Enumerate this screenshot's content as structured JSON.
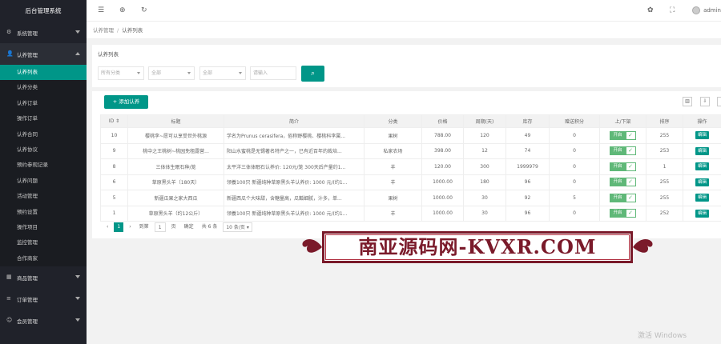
{
  "app_title": "后台管理系统",
  "sidebar": {
    "groups": [
      {
        "label": "系统管理"
      },
      {
        "label": "认养管理"
      },
      {
        "label": "商品管理"
      },
      {
        "label": "订单管理"
      },
      {
        "label": "会员管理"
      }
    ],
    "sub_items": [
      "认养列表",
      "认养分类",
      "认养订单",
      "操作订单",
      "认养合同",
      "认养协议",
      "预约参观记录",
      "认养问题",
      "活动管理",
      "预约设置",
      "操作项目",
      "监控管理",
      "合作商家"
    ]
  },
  "header": {
    "user": "admin"
  },
  "breadcrumb": {
    "parent": "认养管理",
    "sep": "/",
    "current": "认养列表"
  },
  "filter": {
    "title": "认养列表",
    "select1": "所有分类",
    "select2": "全部",
    "select3": "全部",
    "keyword_placeholder": "请输入"
  },
  "toolbar": {
    "add_label": "添加认养"
  },
  "table": {
    "headers": [
      "ID ⇕",
      "标题",
      "简介",
      "分类",
      "价格",
      "周期(天)",
      "库存",
      "赠送积分",
      "上/下架",
      "排序",
      "操作"
    ],
    "rows": [
      {
        "id": "10",
        "title": "樱桃李~愿可以享受世外桃源",
        "intro": "学名为Prunus cerasifera，俗称野樱桃、櫻桃科李属...",
        "cat": "果树",
        "price": "788.00",
        "cycle": "120",
        "stock": "49",
        "points": "0",
        "status": "开启",
        "sort": "255",
        "op": "编辑"
      },
      {
        "id": "9",
        "title": "桃中之王桃树~桃园免租露营...",
        "intro": "阳山水蜜桃是无锡著名特产之一，已有近百年的栽培...",
        "cat": "私家农场",
        "price": "398.00",
        "cycle": "12",
        "stock": "74",
        "points": "0",
        "status": "开启",
        "sort": "253",
        "op": "编辑"
      },
      {
        "id": "8",
        "title": "三体体生眠石种/笼",
        "intro": "太平洋三体体眠石认养价: 120元/笼 300天后产量约1...",
        "cat": "羊",
        "price": "120.00",
        "cycle": "300",
        "stock": "1999979",
        "points": "0",
        "status": "开启",
        "sort": "1",
        "op": "编辑"
      },
      {
        "id": "6",
        "title": "草原黑头羊（180天）",
        "intro": "领養100只 新疆纯种草原黑头羊认养价: 1000 元/(约1...",
        "cat": "羊",
        "price": "1000.00",
        "cycle": "180",
        "stock": "96",
        "points": "0",
        "status": "开启",
        "sort": "255",
        "op": "编辑"
      },
      {
        "id": "5",
        "title": "新疆瓜果之家大西瓜",
        "intro": "新疆西瓜个大味甜，含糖量高，瓜瓤细腻，汁多，单...",
        "cat": "果树",
        "price": "1000.00",
        "cycle": "30",
        "stock": "92",
        "points": "5",
        "status": "开启",
        "sort": "255",
        "op": "编辑"
      },
      {
        "id": "1",
        "title": "草原黑头羊（约12公斤）",
        "intro": "领養100只 新疆纯种草原黑头羊认养价: 1000 元/(约1...",
        "cat": "羊",
        "price": "1000.00",
        "cycle": "30",
        "stock": "96",
        "points": "0",
        "status": "开启",
        "sort": "252",
        "op": "编辑"
      }
    ]
  },
  "pager": {
    "current": "1",
    "goto_label": "到第",
    "goto_value": "1",
    "page_unit": "页",
    "confirm": "确定",
    "total": "共 6 条",
    "per_page": "10 条/页"
  },
  "watermark": {
    "banner_text": "南亚源码网-KVXR.COM",
    "windows": "激活 Windows"
  },
  "colors": {
    "accent": "#009688",
    "sidebar_bg": "#20222a",
    "switch_on": "#5FB878",
    "banner": "#7a1a2a"
  }
}
